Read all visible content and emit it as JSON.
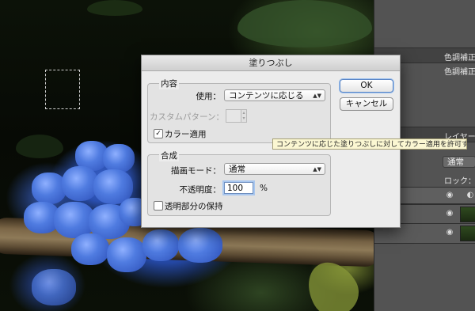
{
  "dialog": {
    "title": "塗りつぶし",
    "contents_group": {
      "label": "内容",
      "use_label": "使用：",
      "use_value": "コンテンツに応じる",
      "custom_pattern_label": "カスタムパターン：",
      "color_adaptation_label": "カラー適用",
      "color_adaptation_checked": true
    },
    "blending_group": {
      "label": "合成",
      "mode_label": "描画モード：",
      "mode_value": "通常",
      "opacity_label": "不透明度：",
      "opacity_value": "100",
      "opacity_unit": "%",
      "preserve_transparency_label": "透明部分の保持",
      "preserve_transparency_checked": false
    },
    "ok_label": "OK",
    "cancel_label": "キャンセル"
  },
  "tooltip": {
    "text": "コンテンツに応じた塗りつぶしに対してカラー適用を許可する"
  },
  "right_panel": {
    "adjustments_tab": "色調補正",
    "adjustments_subtitle": "色調補正を",
    "layers_tab": "レイヤー",
    "blend_mode": "通常",
    "lock_label": "ロック："
  },
  "colors": {
    "dialog_bg": "#ececec",
    "panel_bg": "#535353",
    "tooltip_bg": "#fbf7d2",
    "accent_focus": "#a9c7ef"
  }
}
